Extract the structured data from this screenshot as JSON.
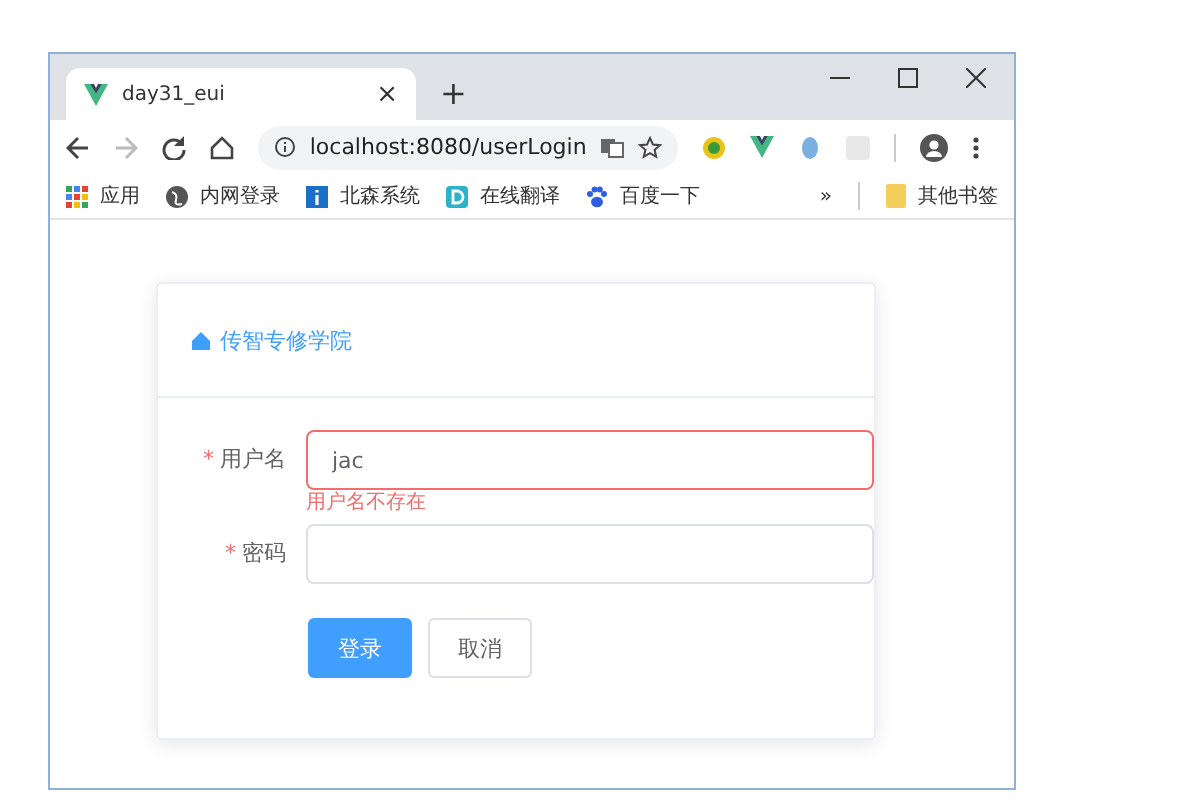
{
  "tab": {
    "title": "day31_eui",
    "close": "×",
    "new_tab": "+"
  },
  "address": {
    "url": "localhost:8080/userLogin"
  },
  "bookmarks": [
    {
      "label": "应用",
      "kind": "apps"
    },
    {
      "label": "内网登录",
      "kind": "globe"
    },
    {
      "label": "北森系统",
      "kind": "info"
    },
    {
      "label": "在线翻译",
      "kind": "d"
    },
    {
      "label": "百度一下",
      "kind": "paw"
    }
  ],
  "bookmarks_more": "»",
  "other_bookmarks": "其他书签",
  "card": {
    "title": "传智专修学院"
  },
  "fields": [
    {
      "marker": "*",
      "label": "用户名",
      "value": "jac",
      "error": "用户名不存在",
      "kind": "text"
    },
    {
      "marker": "*",
      "label": "密码",
      "kind": "password"
    }
  ],
  "buttons": [
    {
      "label": "登录",
      "kind": "primary"
    },
    {
      "label": "取消",
      "kind": "default"
    }
  ]
}
